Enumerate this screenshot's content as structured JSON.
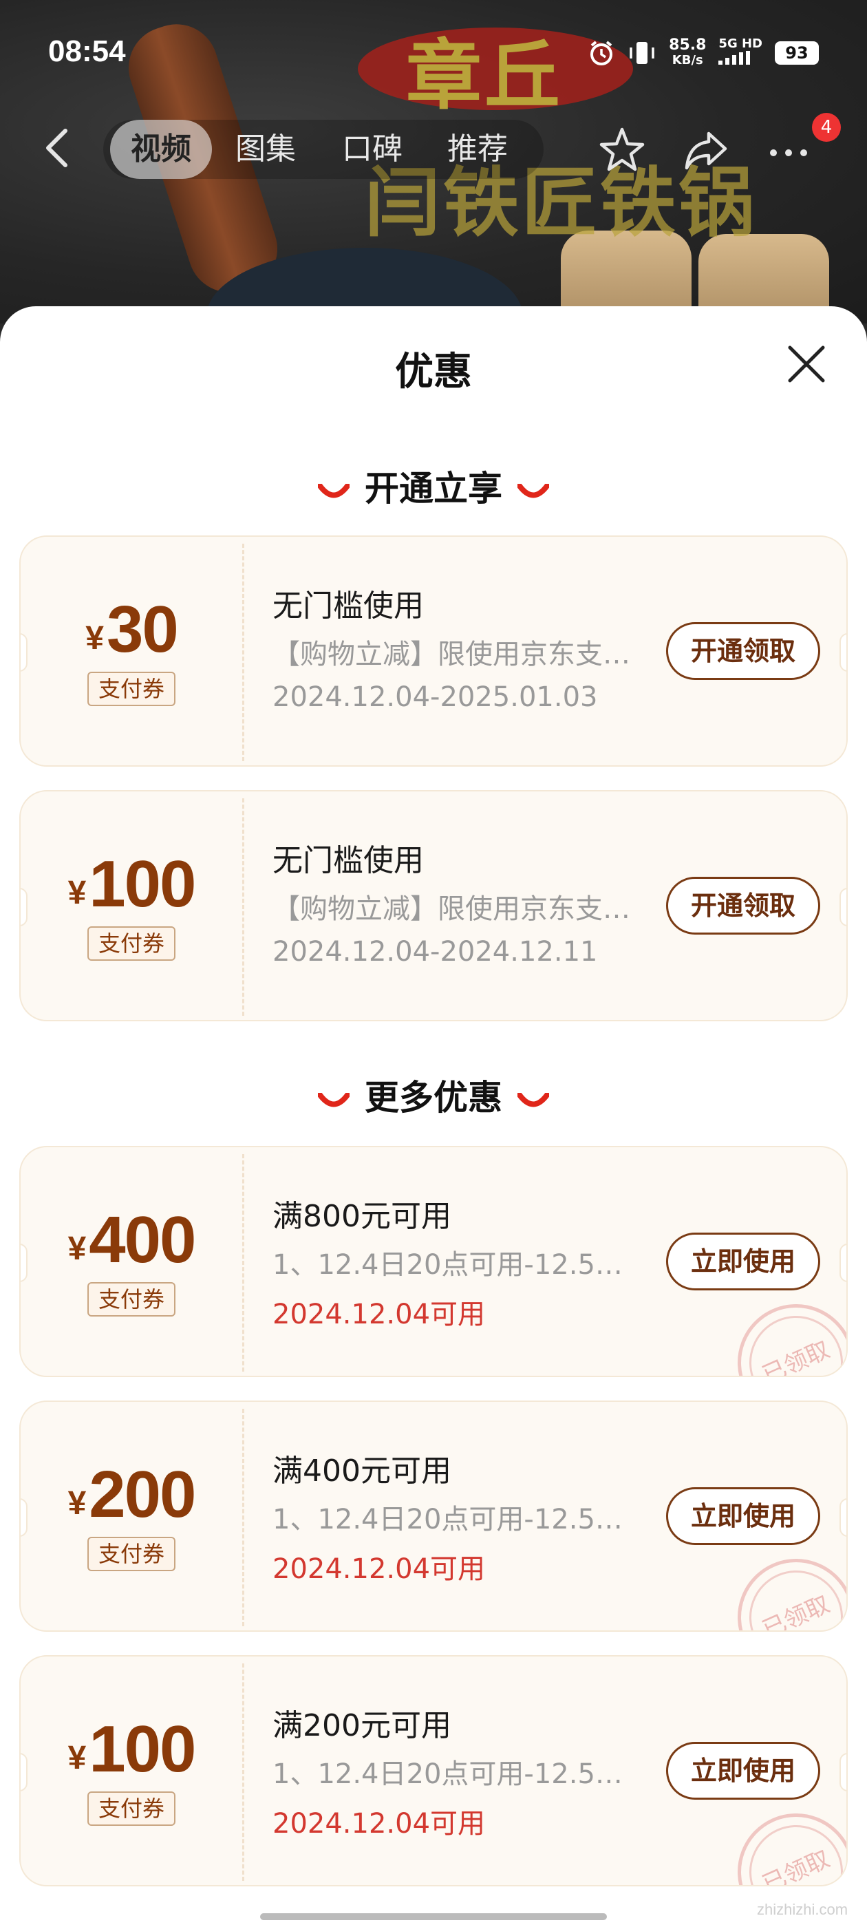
{
  "status_bar": {
    "time": "08:54",
    "net_speed_value": "85.8",
    "net_speed_unit": "KB/s",
    "network": "5G HD",
    "battery": "93"
  },
  "hero": {
    "brand_line1": "章丘",
    "brand_line2": "闫铁匠铁锅"
  },
  "video_nav": {
    "tabs": [
      {
        "label": "视频",
        "active": true
      },
      {
        "label": "图集",
        "active": false
      },
      {
        "label": "口碑",
        "active": false
      },
      {
        "label": "推荐",
        "active": false
      }
    ],
    "more_badge": "4"
  },
  "sheet": {
    "title": "优惠",
    "sections": [
      {
        "title": "开通立享",
        "coupons": [
          {
            "currency": "¥",
            "amount": "30",
            "tag": "支付券",
            "title": "无门槛使用",
            "desc": "【购物立减】限使用京东支付…",
            "date": "2024.12.04-2025.01.03",
            "button": "开通领取",
            "claimed": false
          },
          {
            "currency": "¥",
            "amount": "100",
            "tag": "支付券",
            "title": "无门槛使用",
            "desc": "【购物立减】限使用京东支付…",
            "date": "2024.12.04-2024.12.11",
            "button": "开通领取",
            "claimed": false
          }
        ]
      },
      {
        "title": "更多优惠",
        "coupons": [
          {
            "currency": "¥",
            "amount": "400",
            "tag": "支付券",
            "title": "满800元可用",
            "desc": "1、12.4日20点可用-12.5日…",
            "date": "2024.12.04可用",
            "button": "立即使用",
            "claimed": true,
            "stamp": "已领取"
          },
          {
            "currency": "¥",
            "amount": "200",
            "tag": "支付券",
            "title": "满400元可用",
            "desc": "1、12.4日20点可用-12.5日…",
            "date": "2024.12.04可用",
            "button": "立即使用",
            "claimed": true,
            "stamp": "已领取"
          },
          {
            "currency": "¥",
            "amount": "100",
            "tag": "支付券",
            "title": "满200元可用",
            "desc": "1、12.4日20点可用-12.5日…",
            "date": "2024.12.04可用",
            "button": "立即使用",
            "claimed": true,
            "stamp": "已领取"
          }
        ]
      }
    ]
  },
  "watermark": "zhizhizhi.com",
  "colors": {
    "amount": "#8a3a09",
    "red_date": "#d3382f",
    "button_border": "#7a3b14",
    "coupon_bg": "#fdf9f3",
    "smile_accent": "#e0261a"
  }
}
